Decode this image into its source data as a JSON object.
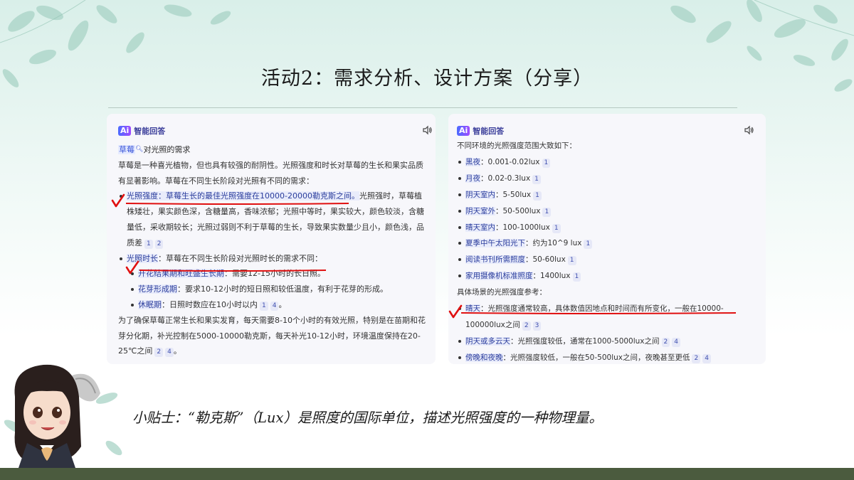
{
  "slide": {
    "title": "活动2：需求分析、设计方案（分享）",
    "tip": "小贴士：“勒克斯”（Lux）是照度的国际单位，描述光照强度的一种物理量。"
  },
  "left_panel": {
    "ai_badge": "Ai",
    "ai_label": "智能回答",
    "query_term": "草莓",
    "query_rest": "对光照的需求",
    "intro": "草莓是一种喜光植物，但也具有较强的耐阴性。光照强度和时长对草莓的生长和果实品质有显著影响。草莓在不同生长阶段对光照有不同的需求：",
    "item1_head": "光照强度：草莓生长的最佳光照强度在10000-20000勒克斯之间。",
    "item1_rest": "光照强时，草莓植株矮壮，果实颜色深，含糖量高，香味浓郁；光照中等时，果实较大，颜色较淡，含糖量低，采收期较长；光照过弱则不利于草莓的生长，导致果实数量少且小，颜色浅，品质差",
    "item1_refs": [
      "1",
      "2"
    ],
    "item2_head": "光照时长",
    "item2_rest": "：草莓在不同生长阶段对光照时长的需求不同：",
    "sub1_head": "开花结果期和旺盛生长期",
    "sub1_rest": "：需要12-15小时的长日照。",
    "sub2_head": "花芽形成期",
    "sub2_rest": "：要求10-12小时的短日照和较低温度，有利于花芽的形成。",
    "sub3_head": "休眠期",
    "sub3_rest": "：日照时数应在10小时以内",
    "sub3_refs": [
      "1",
      "4"
    ],
    "sub3_tail": "。",
    "outro": "为了确保草莓正常生长和果实发育，每天需要8-10个小时的有效光照，特别是在苗期和花芽分化期，补光控制在5000-10000勒克斯，每天补光10-12小时，环境温度保持在20-25℃之间",
    "outro_refs": [
      "2",
      "4"
    ],
    "outro_tail": "。"
  },
  "right_panel": {
    "ai_badge": "Ai",
    "ai_label": "智能回答",
    "intro": "不同环境的光照强度范围大致如下：",
    "ranges": [
      {
        "label": "黑夜",
        "value": "：0.001-0.02lux",
        "ref": "1"
      },
      {
        "label": "月夜",
        "value": "：0.02-0.3lux",
        "ref": "1"
      },
      {
        "label": "阴天室内",
        "value": "：5-50lux",
        "ref": "1"
      },
      {
        "label": "阴天室外",
        "value": "：50-500lux",
        "ref": "1"
      },
      {
        "label": "晴天室内",
        "value": "：100-1000lux",
        "ref": "1"
      },
      {
        "label": "夏季中午太阳光下",
        "value": "：约为10^9 lux",
        "ref": "1"
      },
      {
        "label": "阅读书刊所需照度",
        "value": "：50-60lux",
        "ref": "1"
      },
      {
        "label": "家用摄像机标准照度",
        "value": "：1400lux",
        "ref": "1"
      }
    ],
    "scene_intro": "具体场景的光照强度参考：",
    "scene1_head": "晴天",
    "scene1_rest": "：光照强度通常较高，具体数值因地点和时间而有所变化，一般在10000-100000lux之间",
    "scene1_refs": [
      "2",
      "3"
    ],
    "scene2_head": "阴天或多云天",
    "scene2_rest": "：光照强度较低，通常在1000-5000lux之间",
    "scene2_refs": [
      "2",
      "4"
    ],
    "scene3_head": "傍晚和夜晚",
    "scene3_rest": "：光照强度较低，一般在50-500lux之间，夜晚甚至更低",
    "scene3_refs": [
      "2",
      "4"
    ]
  },
  "colors": {
    "annotation_red": "#e01010",
    "footer_band": "#4b5b3e",
    "ai_accent": "#3a3d9a",
    "link_blue": "#3a55d9"
  },
  "icons": [
    "leaf-decoration",
    "ai-logo-icon",
    "speaker-icon",
    "search-icon",
    "checkmark-icon",
    "avatar-girl"
  ]
}
